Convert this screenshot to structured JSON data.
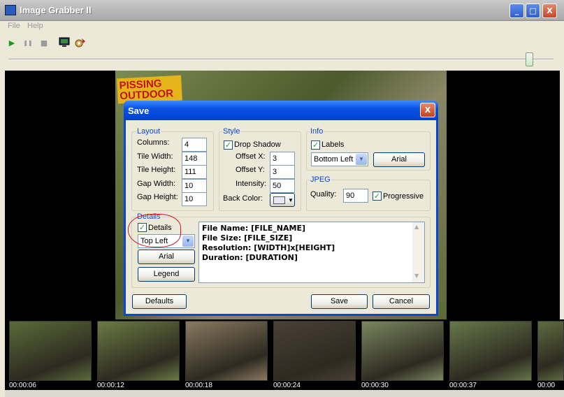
{
  "window": {
    "title": "Image Grabber II",
    "min_label": "_",
    "max_label": "□",
    "close_label": "X"
  },
  "menu": [
    "File",
    "Help"
  ],
  "toolbar": {
    "play": "▶",
    "pause": "❚❚",
    "stop": "■"
  },
  "seek": {
    "position": 0.955
  },
  "video_overlay": {
    "logo_text": "PISSING\nOUTDOOR"
  },
  "dialog": {
    "title": "Save",
    "close_label": "X",
    "layout": {
      "label": "Layout",
      "columns_label": "Columns:",
      "columns": "4",
      "tile_width_label": "Tile Width:",
      "tile_width": "148",
      "tile_height_label": "Tile Height:",
      "tile_height": "111",
      "gap_width_label": "Gap  Width:",
      "gap_width": "10",
      "gap_height_label": "Gap Height:",
      "gap_height": "10"
    },
    "style": {
      "label": "Style",
      "drop_shadow_label": "Drop Shadow",
      "drop_shadow": true,
      "offset_x_label": "Offset X:",
      "offset_x": "3",
      "offset_y_label": "Offset Y:",
      "offset_y": "3",
      "intensity_label": "Intensity:",
      "intensity": "50",
      "back_color_label": "Back Color:"
    },
    "info": {
      "label": "Info",
      "labels_label": "Labels",
      "labels": true,
      "position": "Bottom Left",
      "font_button": "Arial"
    },
    "jpeg": {
      "label": "JPEG",
      "quality_label": "Quality:",
      "quality": "90",
      "progressive_label": "Progressive",
      "progressive": true
    },
    "details": {
      "label": "Details",
      "details_label": "Details",
      "details": true,
      "position": "Top Left",
      "font_button": "Arial",
      "legend_button": "Legend",
      "text_lines": [
        "File Name: [FILE_NAME]",
        "File Size: [FILE_SIZE]",
        "Resolution: [WIDTH]x[HEIGHT]",
        "Duration: [DURATION]"
      ]
    },
    "buttons": {
      "defaults": "Defaults",
      "save": "Save",
      "cancel": "Cancel"
    }
  },
  "thumbnails": [
    {
      "time": "00:00:06",
      "color": "#5a6b3a"
    },
    {
      "time": "00:00:12",
      "color": "#6b7a44"
    },
    {
      "time": "00:00:18",
      "color": "#8a7a62"
    },
    {
      "time": "00:00:24",
      "color": "#4a4038"
    },
    {
      "time": "00:00:30",
      "color": "#7a8660"
    },
    {
      "time": "00:00:37",
      "color": "#66774a"
    },
    {
      "time": "00:00",
      "color": "#5e6b40"
    }
  ]
}
